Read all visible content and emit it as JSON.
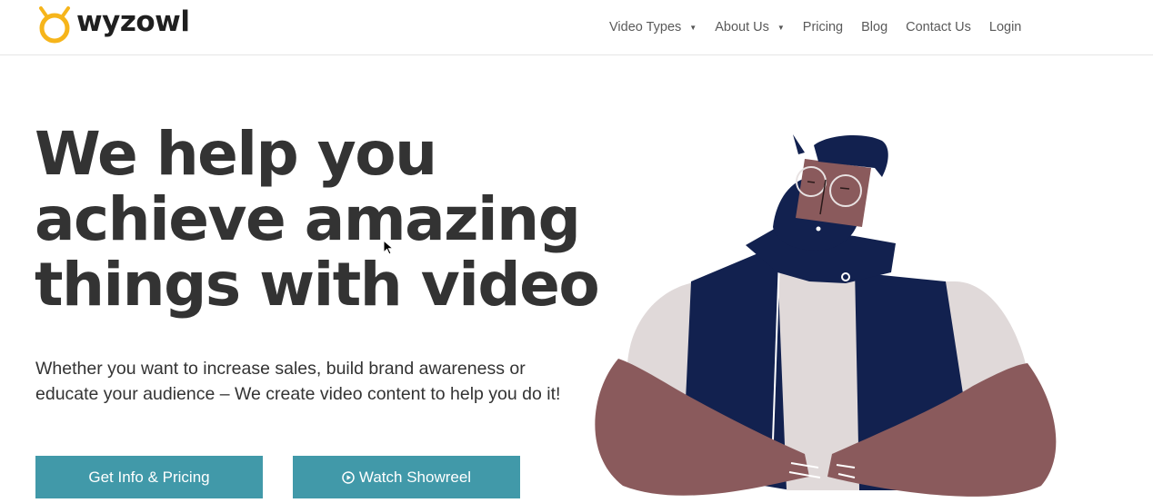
{
  "brand": {
    "name": "wyzowl",
    "accent": "#f6b51b"
  },
  "nav": {
    "items": [
      {
        "label": "Video Types",
        "has_dropdown": true
      },
      {
        "label": "About Us",
        "has_dropdown": true
      },
      {
        "label": "Pricing",
        "has_dropdown": false
      },
      {
        "label": "Blog",
        "has_dropdown": false
      },
      {
        "label": "Contact Us",
        "has_dropdown": false
      },
      {
        "label": "Login",
        "has_dropdown": false
      }
    ],
    "caret": "▼"
  },
  "hero": {
    "headline_lines": [
      "We help you",
      "achieve amazing",
      "things with video"
    ],
    "subtext": "Whether you want to increase sales, build brand awareness or educate your audience – We create video content to help you do it!",
    "primary_button": "Get Info & Pricing",
    "secondary_button": "Watch Showreel"
  },
  "colors": {
    "button": "#4199a9",
    "heading": "#333333",
    "vest": "#12214f",
    "skin": "#8a5a5c",
    "shirt": "#e0d9d9"
  },
  "icons": {
    "play": "play-circle-icon",
    "logo": "wyzowl-owl-icon"
  }
}
